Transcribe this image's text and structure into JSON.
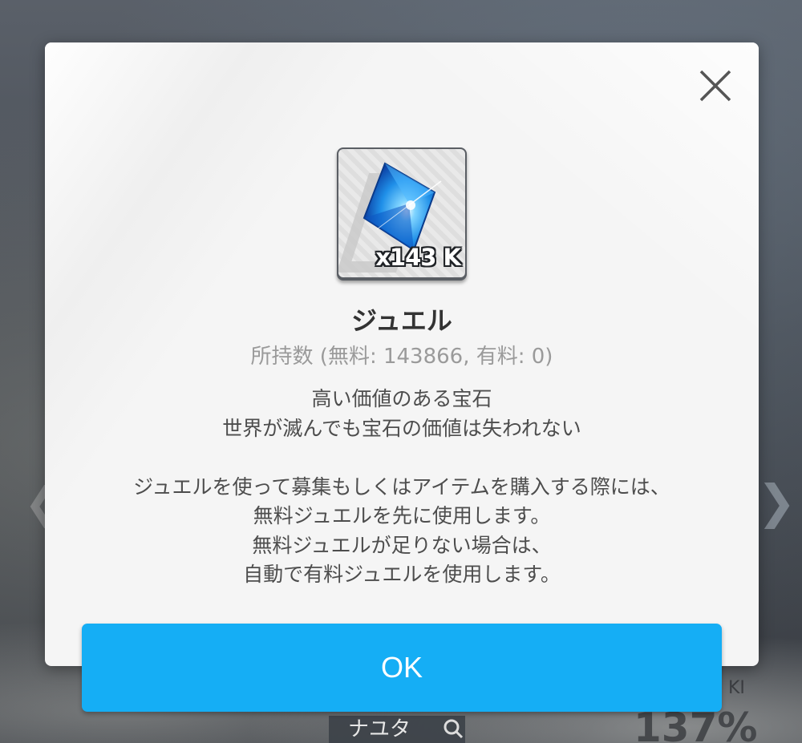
{
  "background": {
    "name_tag": "ナユタ",
    "stat_value": "137%",
    "stat_label": "KI"
  },
  "dialog": {
    "item": {
      "count_label": "x143 K",
      "icon": "blue-jewel-icon"
    },
    "title": "ジュエル",
    "owned": "所持数 (無料: 143866, 有料: 0)",
    "description_lines": [
      "高い価値のある宝石",
      "世界が滅んでも宝石の価値は失われない",
      "",
      "ジュエルを使って募集もしくはアイテムを購入する際には、",
      "無料ジュエルを先に使用します。",
      "無料ジュエルが足りない場合は、",
      "自動で有料ジュエルを使用します。"
    ],
    "close_icon": "close-icon",
    "ok_label": "OK"
  },
  "colors": {
    "ok_button": "#15aef5",
    "dialog_background": "#f5f5f5",
    "title_text": "#333333",
    "owned_text": "#9a9a9a"
  }
}
